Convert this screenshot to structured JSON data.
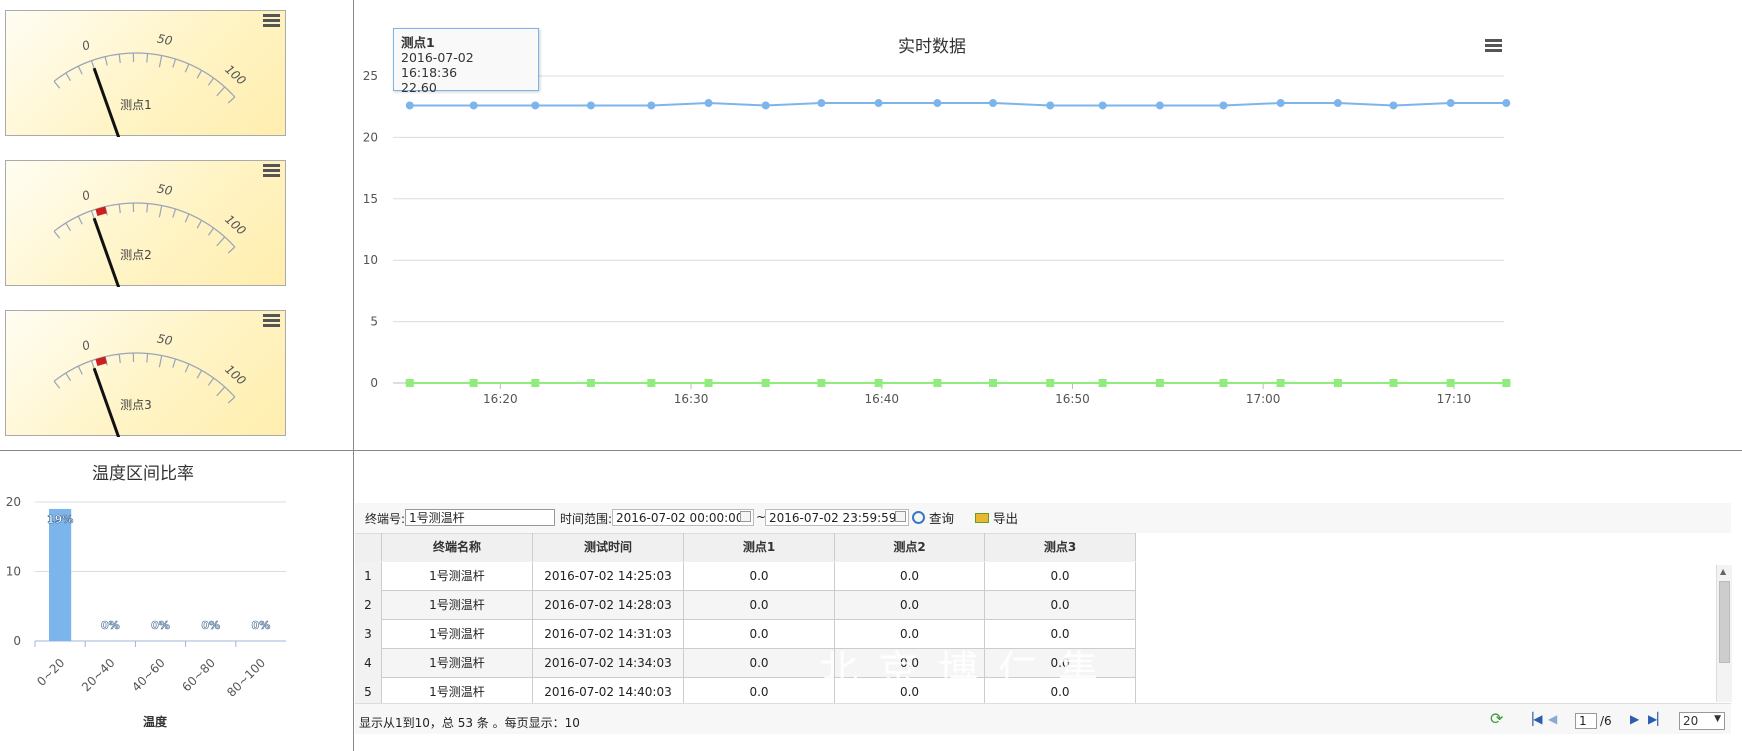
{
  "gauges": [
    {
      "label": "测点1",
      "value": 0,
      "ticks": [
        "0",
        "50",
        "100"
      ],
      "menu": "chart-menu-icon"
    },
    {
      "label": "测点2",
      "value": 0,
      "ticks": [
        "0",
        "50",
        "100"
      ],
      "menu": "chart-menu-icon"
    },
    {
      "label": "测点3",
      "value": 0,
      "ticks": [
        "0",
        "50",
        "100"
      ],
      "menu": "chart-menu-icon"
    }
  ],
  "main_chart": {
    "title": "实时数据",
    "menu": "chart-menu-icon",
    "tooltip": {
      "series": "测点1",
      "time": "2016-07-02 16:18:36",
      "value": "22.60"
    }
  },
  "bar_chart": {
    "title": "温度区间比率",
    "xlabel": "温度"
  },
  "chart_data": [
    {
      "type": "line",
      "title": "实时数据",
      "x_ticks": [
        "16:20",
        "16:30",
        "16:40",
        "16:50",
        "17:00",
        "17:10"
      ],
      "y_ticks": [
        "0",
        "5",
        "10",
        "15",
        "20",
        "25"
      ],
      "ylim": [
        0,
        25
      ],
      "xlim": [
        "16:15",
        "17:12"
      ],
      "grid": true,
      "series": [
        {
          "name": "测点1",
          "color": "#7cb5ec",
          "marker": "circle",
          "x": [
            "16:15:15",
            "16:18:36",
            "16:21:50",
            "16:24:45",
            "16:27:55",
            "16:30:55",
            "16:33:55",
            "16:36:50",
            "16:39:50",
            "16:42:55",
            "16:45:50",
            "16:48:50",
            "16:51:35",
            "16:54:35",
            "16:57:55",
            "17:00:55",
            "17:03:55",
            "17:06:50",
            "17:09:50",
            "17:12:45"
          ],
          "values": [
            22.6,
            22.6,
            22.6,
            22.6,
            22.6,
            22.8,
            22.6,
            22.8,
            22.8,
            22.8,
            22.8,
            22.6,
            22.6,
            22.6,
            22.6,
            22.8,
            22.8,
            22.6,
            22.8,
            22.8
          ]
        },
        {
          "color": "#90ed7d",
          "marker": "square",
          "x": [
            "16:15:15",
            "16:18:36",
            "16:21:50",
            "16:24:45",
            "16:27:55",
            "16:30:55",
            "16:33:55",
            "16:36:50",
            "16:39:50",
            "16:42:55",
            "16:45:50",
            "16:48:50",
            "16:51:35",
            "16:54:35",
            "16:57:55",
            "17:00:55",
            "17:03:55",
            "17:06:50",
            "17:09:50",
            "17:12:45"
          ],
          "values": [
            0,
            0,
            0,
            0,
            0,
            0,
            0,
            0,
            0,
            0,
            0,
            0,
            0,
            0,
            0,
            0,
            0,
            0,
            0,
            0
          ]
        },
        {
          "color": "#434348",
          "marker": "circle",
          "x": [
            "16:15:15",
            "16:18:36",
            "16:21:50",
            "16:24:45",
            "16:27:55",
            "16:30:55",
            "16:33:55",
            "16:36:50",
            "16:39:50",
            "16:42:55",
            "16:45:50",
            "16:48:50",
            "16:51:35",
            "16:54:35",
            "16:57:55",
            "17:00:55",
            "17:03:55",
            "17:06:50",
            "17:09:50",
            "17:12:45"
          ],
          "values": [
            0,
            0,
            0,
            0,
            0,
            0,
            0,
            0,
            0,
            0,
            0,
            0,
            0,
            0,
            0,
            0,
            0,
            0,
            0,
            0
          ]
        }
      ]
    },
    {
      "type": "bar",
      "title": "温度区间比率",
      "xlabel": "温度",
      "categories": [
        "0~20",
        "20~40",
        "40~60",
        "60~80",
        "80~100"
      ],
      "values": [
        19,
        0,
        0,
        0,
        0
      ],
      "data_labels": [
        "19%",
        "0%",
        "0%",
        "0%",
        "0%"
      ],
      "y_ticks": [
        "0",
        "10",
        "20"
      ],
      "ylim": [
        0,
        20
      ],
      "color": "#7cb5ec"
    }
  ],
  "filter": {
    "terminal_label": "终端号:",
    "terminal_value": "1号测温杆",
    "time_label": "时间范围:",
    "start_value": "2016-07-02 00:00:00",
    "sep": "~",
    "end_value": "2016-07-02 23:59:59",
    "query_label": "查询",
    "export_label": "导出"
  },
  "table": {
    "headers": [
      "终端名称",
      "测试时间",
      "测点1",
      "测点2",
      "测点3"
    ],
    "rows": [
      {
        "num": "1",
        "cells": [
          "1号测温杆",
          "2016-07-02 14:25:03",
          "0.0",
          "0.0",
          "0.0"
        ]
      },
      {
        "num": "2",
        "cells": [
          "1号测温杆",
          "2016-07-02 14:28:03",
          "0.0",
          "0.0",
          "0.0"
        ]
      },
      {
        "num": "3",
        "cells": [
          "1号测温杆",
          "2016-07-02 14:31:03",
          "0.0",
          "0.0",
          "0.0"
        ]
      },
      {
        "num": "4",
        "cells": [
          "1号测温杆",
          "2016-07-02 14:34:03",
          "0.0",
          "0.0",
          "0.0"
        ]
      },
      {
        "num": "5",
        "cells": [
          "1号测温杆",
          "2016-07-02 14:40:03",
          "0.0",
          "0.0",
          "0.0"
        ]
      }
    ]
  },
  "footer": {
    "summary": "显示从1到10，总 53 条 。每页显示：10",
    "page_value": "1",
    "page_total": "/6",
    "page_size": "20"
  }
}
